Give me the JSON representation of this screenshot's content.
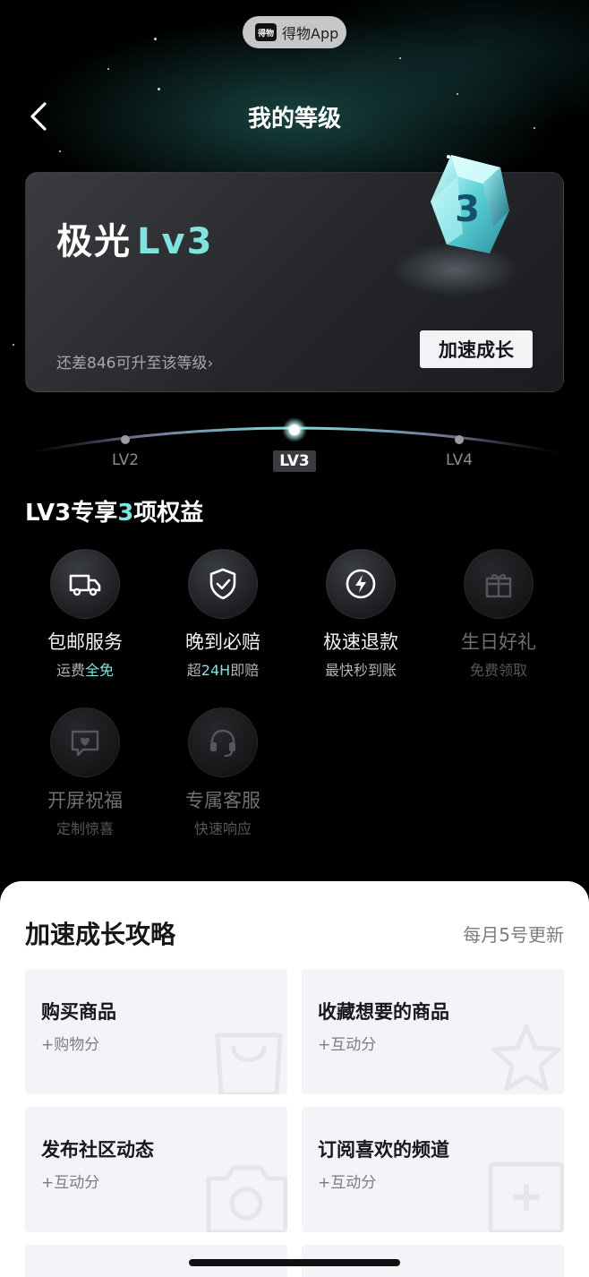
{
  "app_badge": {
    "logo_text": "得物",
    "name": "得物App"
  },
  "header": {
    "title": "我的等级",
    "back_icon": "chevron-left-icon"
  },
  "level_card": {
    "name_prefix": "极光",
    "level": "Lv3",
    "gem_number": "3",
    "gap_text": "还差846可升至该等级",
    "gap_arrow": "›",
    "action_label": "加速成长",
    "accent_color": "#7fe3e0"
  },
  "track": {
    "prev": "LV2",
    "current": "LV3",
    "next": "LV4"
  },
  "benefits": {
    "title_prefix": "LV3专享",
    "title_count": "3",
    "title_suffix": "项权益",
    "items": [
      {
        "name": "包邮服务",
        "sub_a": "运费",
        "sub_hl": "全免",
        "sub_b": "",
        "icon": "truck-icon",
        "enabled": true
      },
      {
        "name": "晚到必赔",
        "sub_a": "超",
        "sub_hl": "24H",
        "sub_b": "即赔",
        "icon": "shield-check-icon",
        "enabled": true
      },
      {
        "name": "极速退款",
        "sub_a": "最快秒到账",
        "sub_hl": "",
        "sub_b": "",
        "icon": "lightning-icon",
        "enabled": true
      },
      {
        "name": "生日好礼",
        "sub_a": "免费领取",
        "sub_hl": "",
        "sub_b": "",
        "icon": "gift-icon",
        "enabled": false
      },
      {
        "name": "开屏祝福",
        "sub_a": "定制惊喜",
        "sub_hl": "",
        "sub_b": "",
        "icon": "message-heart-icon",
        "enabled": false
      },
      {
        "name": "专属客服",
        "sub_a": "快速响应",
        "sub_hl": "",
        "sub_b": "",
        "icon": "headset-icon",
        "enabled": false
      }
    ]
  },
  "strategy": {
    "title": "加速成长攻略",
    "note": "每月5号更新",
    "tasks": [
      {
        "name": "购买商品",
        "reward": "+购物分",
        "icon": "shopping-bag-icon"
      },
      {
        "name": "收藏想要的商品",
        "reward": "+互动分",
        "icon": "star-icon"
      },
      {
        "name": "发布社区动态",
        "reward": "+互动分",
        "icon": "camera-icon"
      },
      {
        "name": "订阅喜欢的频道",
        "reward": "+互动分",
        "icon": "plus-square-icon"
      }
    ]
  }
}
